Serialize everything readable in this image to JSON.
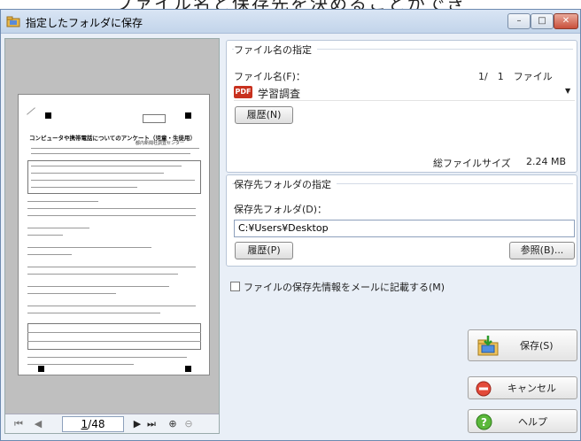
{
  "caption": "ファイル名と保存先を決めることができ",
  "window": {
    "title": "指定したフォルダに保存",
    "minimize": "–",
    "maximize": "□",
    "close": "✕"
  },
  "preview": {
    "page_current": "1",
    "page_total": "/48",
    "document_title": "コンピュータや携帯電話についてのアンケート（児童・生徒用）"
  },
  "filename_section": {
    "title": "ファイル名の指定",
    "label": "ファイル名(F)：",
    "counter": "1/　1　ファイル",
    "value": "学習調査",
    "badge": "PDF",
    "history_button": "履歴(N)",
    "total_size_label": "総ファイルサイズ",
    "total_size_value": "2.24 MB"
  },
  "folder_section": {
    "title": "保存先フォルダの指定",
    "label": "保存先フォルダ(D)：",
    "path": "C:¥Users¥Desktop",
    "history_button": "履歴(P)",
    "browse_button": "参照(B)..."
  },
  "email_option": {
    "label": "ファイルの保存先情報をメールに記載する(M)",
    "checked": false
  },
  "actions": {
    "save": "保存(S)",
    "cancel": "キャンセル",
    "help": "ヘルプ"
  }
}
